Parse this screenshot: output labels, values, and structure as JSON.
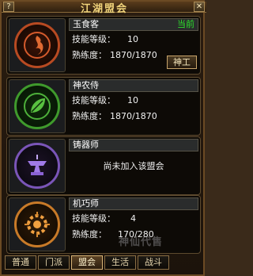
{
  "window": {
    "title": "江湖盟会",
    "help_label": "?",
    "close_label": "✕"
  },
  "guilds": [
    {
      "name": "玉食客",
      "status": "当前",
      "skill_label": "技能等级：",
      "skill_value": "10",
      "prof_label": "熟练度：",
      "prof_value": "1870/1870",
      "action": "神工",
      "emblem": "flame-ring-icon",
      "emblem_color": "#c8502a"
    },
    {
      "name": "神农侍",
      "skill_label": "技能等级：",
      "skill_value": "10",
      "prof_label": "熟练度：",
      "prof_value": "1870/1870",
      "emblem": "leaf-ring-icon",
      "emblem_color": "#4aa832"
    },
    {
      "name": "铸器师",
      "message": "尚未加入该盟会",
      "emblem": "anvil-icon",
      "emblem_color": "#9b6be0"
    },
    {
      "name": "机巧师",
      "skill_label": "技能等级：",
      "skill_value": "4",
      "prof_label": "熟练度：",
      "prof_value": "170/280",
      "emblem": "gear-ring-icon",
      "emblem_color": "#e08a2a"
    }
  ],
  "tabs": [
    {
      "label": "普通",
      "active": false
    },
    {
      "label": "门派",
      "active": false
    },
    {
      "label": "盟会",
      "active": true
    },
    {
      "label": "生活",
      "active": false
    },
    {
      "label": "战斗",
      "active": false
    }
  ],
  "watermark": "神仙代售"
}
